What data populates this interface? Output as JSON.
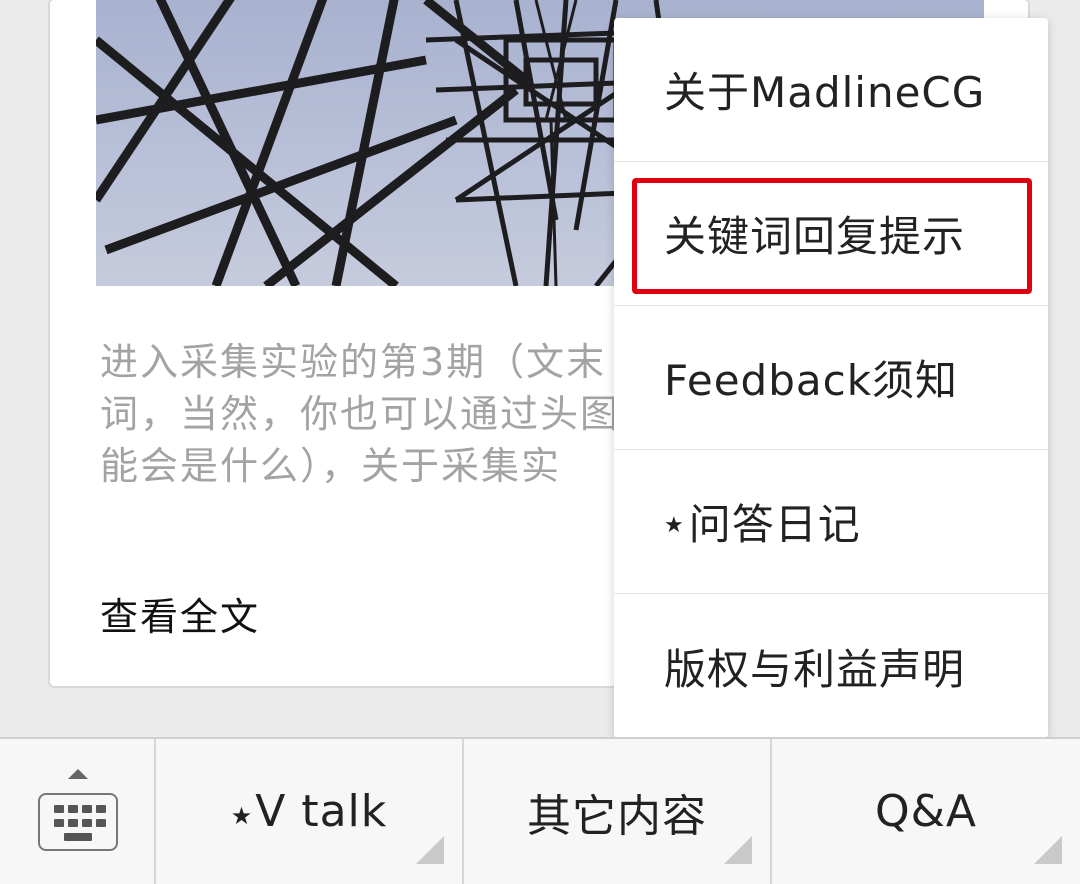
{
  "article": {
    "excerpt_lines": [
      "进入采集实验的第3期（文末",
      "词，当然，你也可以通过头图",
      "能会是什么），关于采集实"
    ],
    "read_more_label": "查看全文"
  },
  "menu": {
    "items": [
      {
        "label": "关于MadlineCG",
        "star": ""
      },
      {
        "label": "关键词回复提示",
        "star": ""
      },
      {
        "label": "Feedback须知",
        "star": ""
      },
      {
        "label": "问答日记",
        "star": "★"
      },
      {
        "label": "版权与利益声明",
        "star": ""
      }
    ],
    "highlighted_index": 1
  },
  "bottom_bar": {
    "tabs": [
      {
        "label": "V talk",
        "star": "★"
      },
      {
        "label": "其它内容",
        "star": ""
      },
      {
        "label": "Q&A",
        "star": ""
      }
    ]
  },
  "colors": {
    "highlight_border": "#e0000f",
    "background": "#ebebeb",
    "excerpt_text": "#a3a3a3"
  }
}
